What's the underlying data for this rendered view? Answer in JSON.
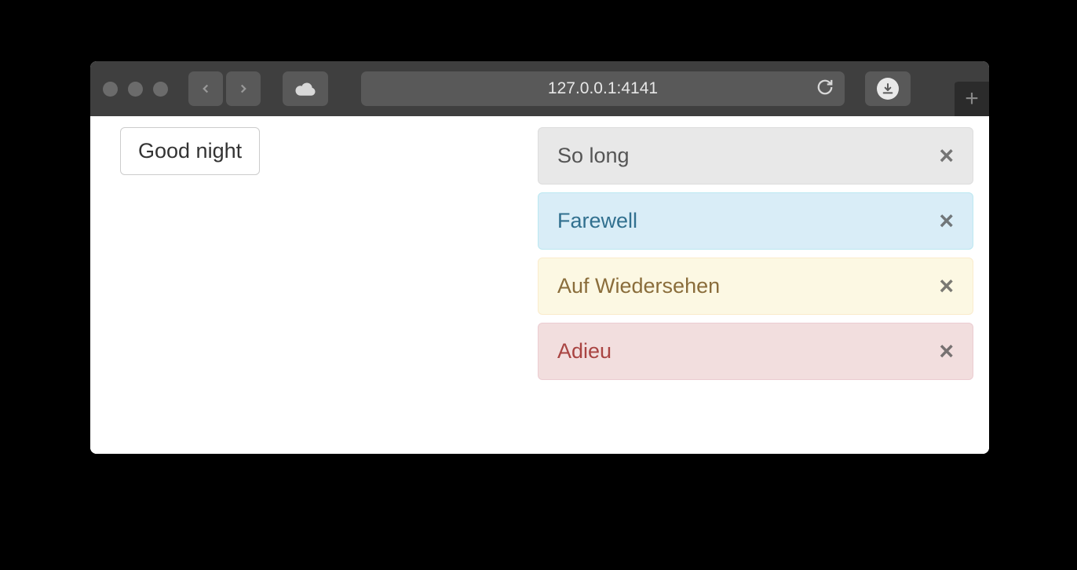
{
  "browser": {
    "address": "127.0.0.1:4141"
  },
  "button": {
    "label": "Good night"
  },
  "alerts": [
    {
      "text": "So long",
      "variant": "default"
    },
    {
      "text": "Farewell",
      "variant": "info"
    },
    {
      "text": "Auf Wiedersehen",
      "variant": "warning"
    },
    {
      "text": "Adieu",
      "variant": "danger"
    }
  ]
}
